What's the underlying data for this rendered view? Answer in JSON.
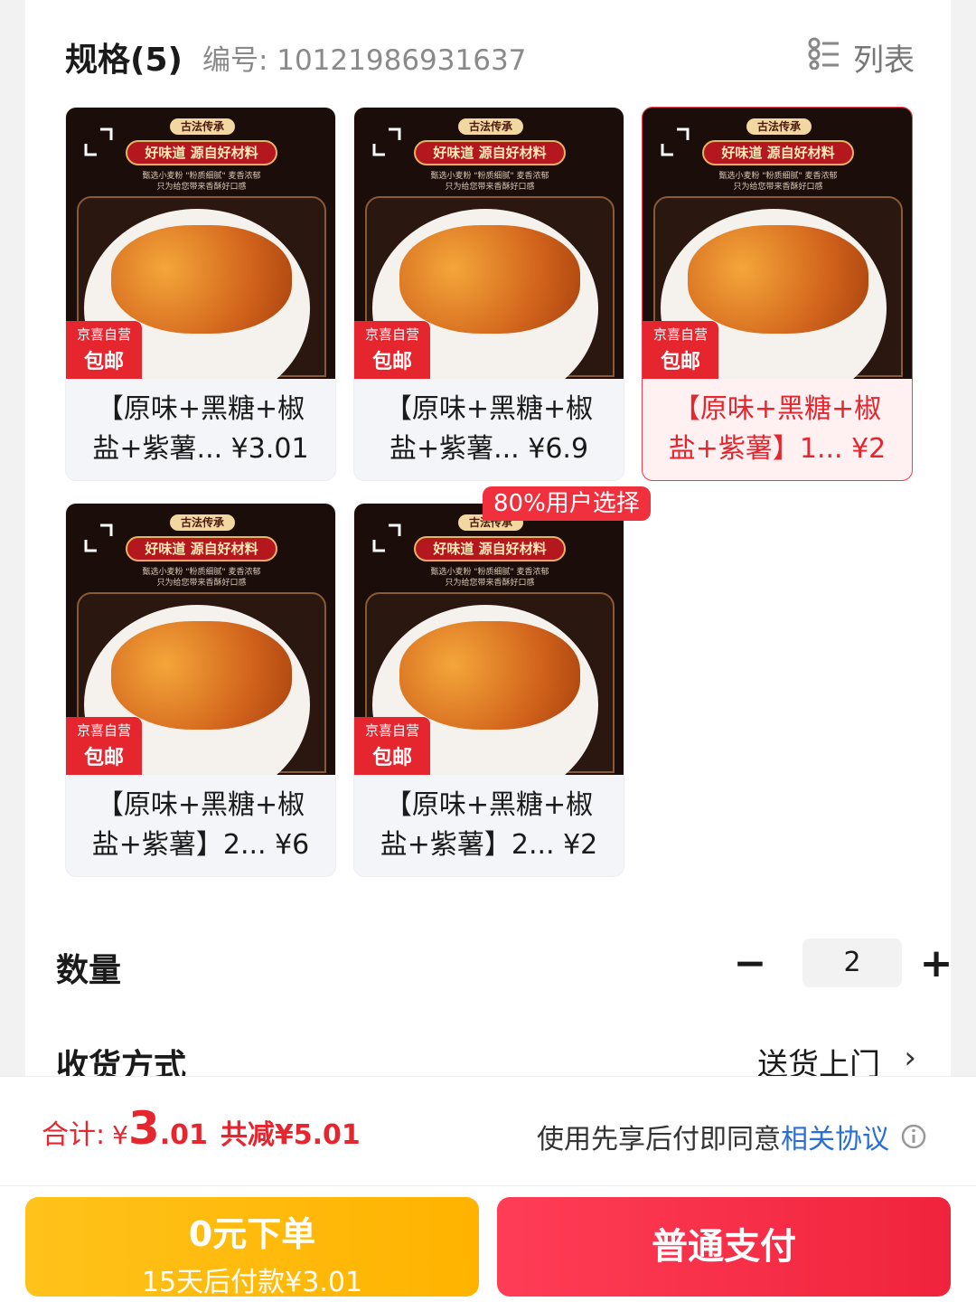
{
  "spec": {
    "title": "规格(5)",
    "code": "编号: 10121986931637",
    "view_label": "列表"
  },
  "thumbnail": {
    "banner_top": "古法传承",
    "banner": "好味道 源自好材料",
    "sub_line1": "甄选小麦粉 \"粉质细腻\" 麦香浓郁",
    "sub_line2": "只为给您带来香酥好口感",
    "badge_self": "京喜自营",
    "badge_free": "包邮"
  },
  "cards": [
    {
      "title": "【原味+黑糖+椒\n盐+紫薯...  ¥3.01",
      "selected": false
    },
    {
      "title": "【原味+黑糖+椒\n盐+紫薯...  ¥6.9",
      "selected": false
    },
    {
      "title": "【原味+黑糖+椒\n盐+紫薯】1...  ¥2",
      "selected": true
    },
    {
      "title": "【原味+黑糖+椒\n盐+紫薯】2...  ¥6",
      "selected": false
    },
    {
      "title": "【原味+黑糖+椒\n盐+紫薯】2...  ¥2",
      "selected": false
    }
  ],
  "popular_tag": "80%用户选择",
  "quantity": {
    "label": "数量",
    "minus": "−",
    "value": "2",
    "plus": "+"
  },
  "delivery": {
    "label": "收货方式",
    "value": "送货上门",
    "chevron": "›"
  },
  "footer": {
    "total_label": "合计:",
    "currency": "¥",
    "total_int": "3",
    "total_dec": ".01",
    "discount": "共减¥5.01",
    "agreement_text": "使用先享后付即同意",
    "agreement_link": "相关协议",
    "paylater_line1": "0元下单",
    "paylater_line2": "15天后付款¥3.01",
    "pay_label": "普通支付"
  },
  "colors": {
    "accent_red": "#e5262f",
    "paylater_yellow": "#ffb300",
    "link_blue": "#2a6fd6"
  }
}
